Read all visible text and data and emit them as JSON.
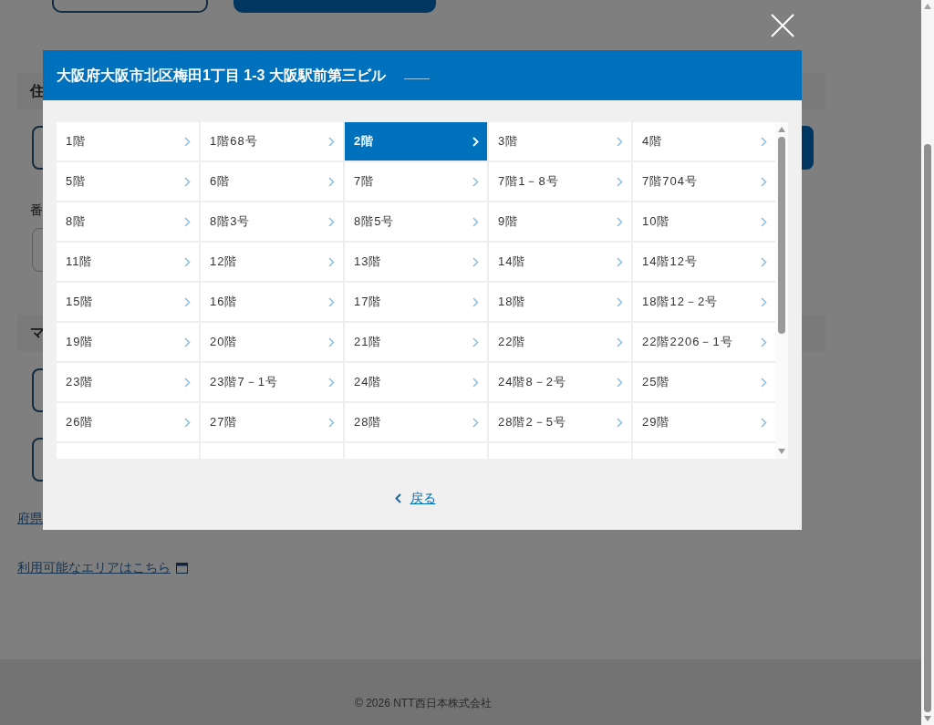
{
  "page": {
    "section_1": {
      "heading": "住",
      "field_label": "番"
    },
    "section_2": {
      "heading": "マ"
    },
    "links": [
      {
        "kind": "plain",
        "text": "府県"
      },
      {
        "kind": "external",
        "text": "利用可能なエリアはこちら"
      }
    ]
  },
  "footer": {
    "copyright": "© 2026 NTT西日本株式会社"
  },
  "modal": {
    "title": "大阪府大阪市北区梅田1丁目 1-3 大阪駅前第三ビル",
    "items": [
      {
        "label": "1階",
        "selected": false
      },
      {
        "label": "1階68号",
        "selected": false
      },
      {
        "label": "2階",
        "selected": true
      },
      {
        "label": "3階",
        "selected": false
      },
      {
        "label": "4階",
        "selected": false
      },
      {
        "label": "5階",
        "selected": false
      },
      {
        "label": "6階",
        "selected": false
      },
      {
        "label": "7階",
        "selected": false
      },
      {
        "label": "7階1－8号",
        "selected": false
      },
      {
        "label": "7階704号",
        "selected": false
      },
      {
        "label": "8階",
        "selected": false
      },
      {
        "label": "8階3号",
        "selected": false
      },
      {
        "label": "8階5号",
        "selected": false
      },
      {
        "label": "9階",
        "selected": false
      },
      {
        "label": "10階",
        "selected": false
      },
      {
        "label": "11階",
        "selected": false
      },
      {
        "label": "12階",
        "selected": false
      },
      {
        "label": "13階",
        "selected": false
      },
      {
        "label": "14階",
        "selected": false
      },
      {
        "label": "14階12号",
        "selected": false
      },
      {
        "label": "15階",
        "selected": false
      },
      {
        "label": "16階",
        "selected": false
      },
      {
        "label": "17階",
        "selected": false
      },
      {
        "label": "18階",
        "selected": false
      },
      {
        "label": "18階12－2号",
        "selected": false
      },
      {
        "label": "19階",
        "selected": false
      },
      {
        "label": "20階",
        "selected": false
      },
      {
        "label": "21階",
        "selected": false
      },
      {
        "label": "22階",
        "selected": false
      },
      {
        "label": "22階2206－1号",
        "selected": false
      },
      {
        "label": "23階",
        "selected": false
      },
      {
        "label": "23階7－1号",
        "selected": false
      },
      {
        "label": "24階",
        "selected": false
      },
      {
        "label": "24階8－2号",
        "selected": false
      },
      {
        "label": "25階",
        "selected": false
      },
      {
        "label": "26階",
        "selected": false
      },
      {
        "label": "27階",
        "selected": false
      },
      {
        "label": "28階",
        "selected": false
      },
      {
        "label": "28階2－5号",
        "selected": false
      },
      {
        "label": "29階",
        "selected": false
      }
    ],
    "back_link": "戻る"
  }
}
